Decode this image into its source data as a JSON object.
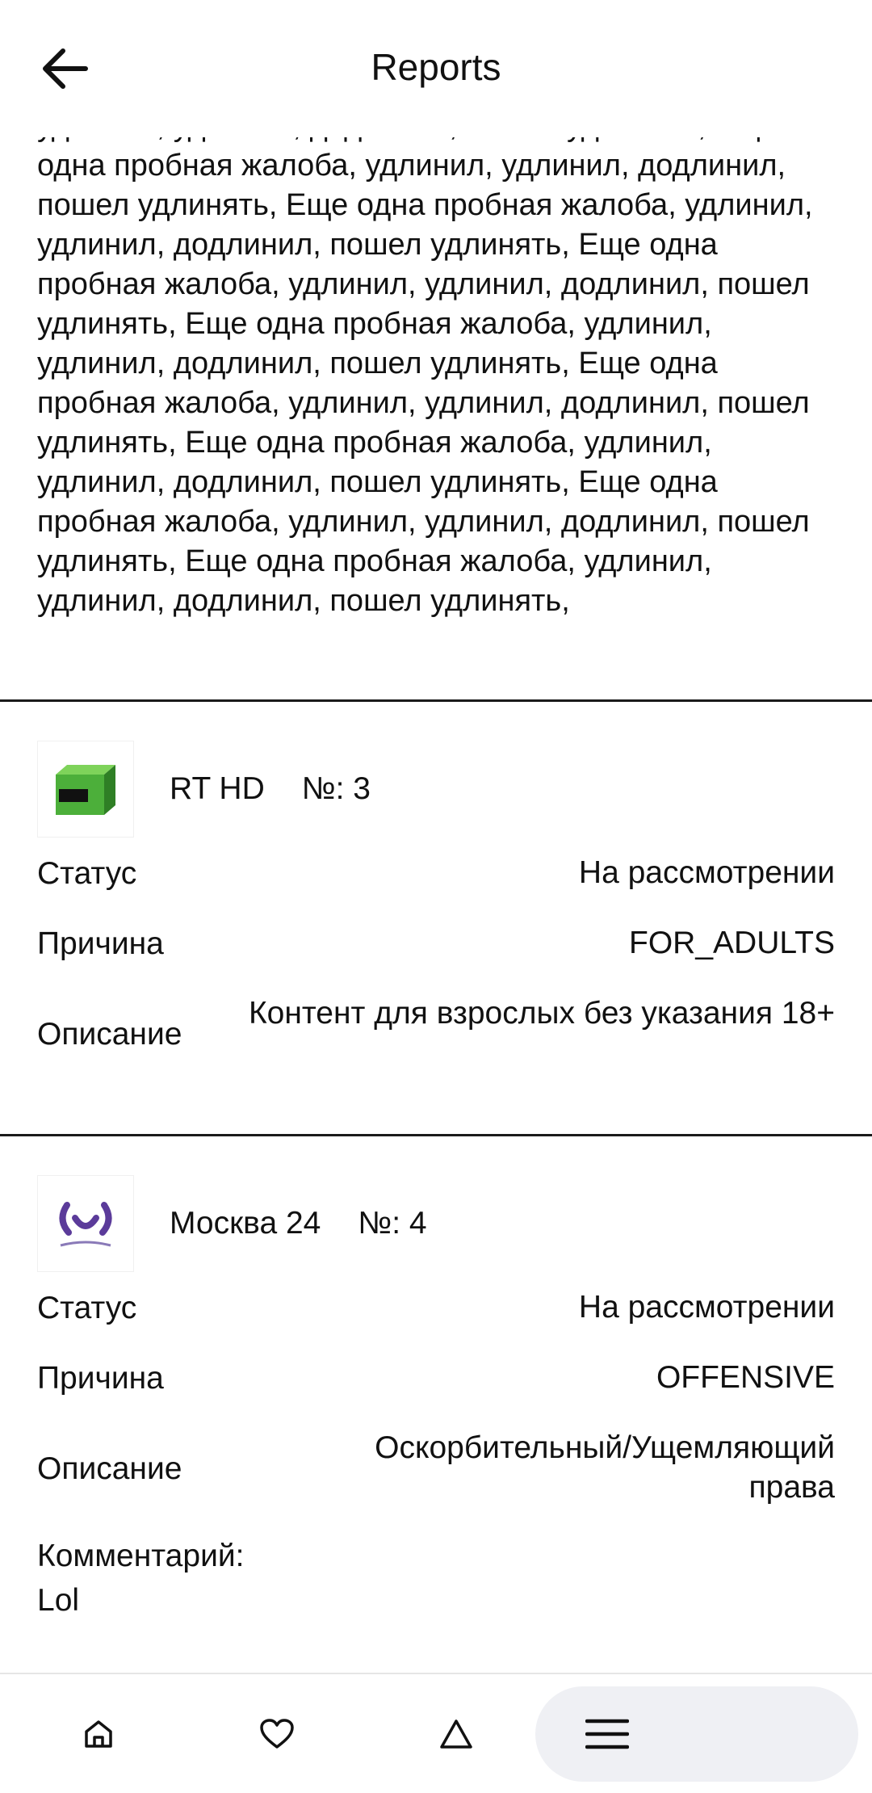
{
  "header": {
    "title": "Reports",
    "back_icon": "arrow-left-icon"
  },
  "previous_comment": {
    "text": "удлинил, удлинил, додлинил, пошел удлинять, Еще одна пробная жалоба, удлинил, удлинил, додлинил, пошел удлинять, Еще одна пробная жалоба, удлинил, удлинил, додлинил, пошел удлинять, Еще одна пробная жалоба, удлинил, удлинил, додлинил, пошел удлинять, Еще одна пробная жалоба, удлинил, удлинил, додлинил, пошел удлинять, Еще одна пробная жалоба, удлинил, удлинил, додлинил, пошел удлинять, Еще одна пробная жалоба, удлинил, удлинил, додлинил, пошел удлинять, Еще одна пробная жалоба, удлинил, удлинил, додлинил, пошел удлинять, Еще одна пробная жалоба, удлинил, удлинил, додлинил, пошел удлинять,"
  },
  "reports": [
    {
      "channel": "RT HD",
      "number": "№: 3",
      "logo_icon": "rt-d-logo-icon",
      "status_label": "Статус",
      "status_value": "На рассмотрении",
      "reason_label": "Причина",
      "reason_value": "FOR_ADULTS",
      "description_label": "Описание",
      "description_value": "Контент для взрослых без указания 18+"
    },
    {
      "channel": "Москва 24",
      "number": "№: 4",
      "logo_icon": "moscow-24-logo-icon",
      "status_label": "Статус",
      "status_value": "На рассмотрении",
      "reason_label": "Причина",
      "reason_value": "OFFENSIVE",
      "description_label": "Описание",
      "description_value": "Оскорбительный/Ущемляющий права",
      "comment_label": "Комментарий:",
      "comment_value": "Lol"
    }
  ],
  "bottom_nav": {
    "items": [
      {
        "icon": "home-icon",
        "active": false
      },
      {
        "icon": "heart-icon",
        "active": false
      },
      {
        "icon": "triangle-icon",
        "active": false
      },
      {
        "icon": "menu-icon",
        "active": true
      }
    ]
  }
}
